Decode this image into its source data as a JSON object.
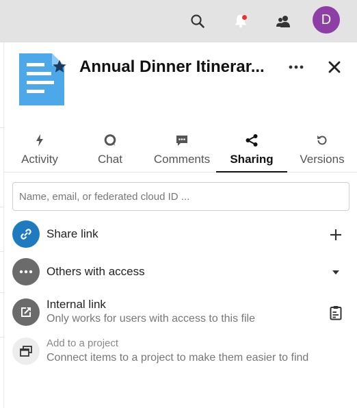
{
  "header": {
    "avatar_initial": "D",
    "icons": [
      "search-icon",
      "notifications-icon",
      "contacts-icon"
    ],
    "notification_dot_color": "#e9322d",
    "avatar_color": "#8e3fa6"
  },
  "file": {
    "title": "Annual Dinner Itinerar...",
    "icon": "document-icon",
    "favorite": true
  },
  "tabs": [
    {
      "label": "Activity",
      "icon": "activity-icon"
    },
    {
      "label": "Chat",
      "icon": "chat-icon"
    },
    {
      "label": "Comments",
      "icon": "comments-icon"
    },
    {
      "label": "Sharing",
      "icon": "share-icon",
      "active": true
    },
    {
      "label": "Versions",
      "icon": "history-icon"
    }
  ],
  "sharing": {
    "input_placeholder": "Name, email, or federated cloud ID ...",
    "share_link": {
      "label": "Share link",
      "color": "#1f7bc0"
    },
    "others_access": {
      "label": "Others with access",
      "color": "#6b6b6b"
    },
    "internal_link": {
      "label": "Internal link",
      "sublabel": "Only works for users with access to this file",
      "color": "#6b6b6b"
    },
    "project": {
      "label": "Add to a project",
      "sublabel": "Connect items to a project to make them easier to find"
    }
  }
}
